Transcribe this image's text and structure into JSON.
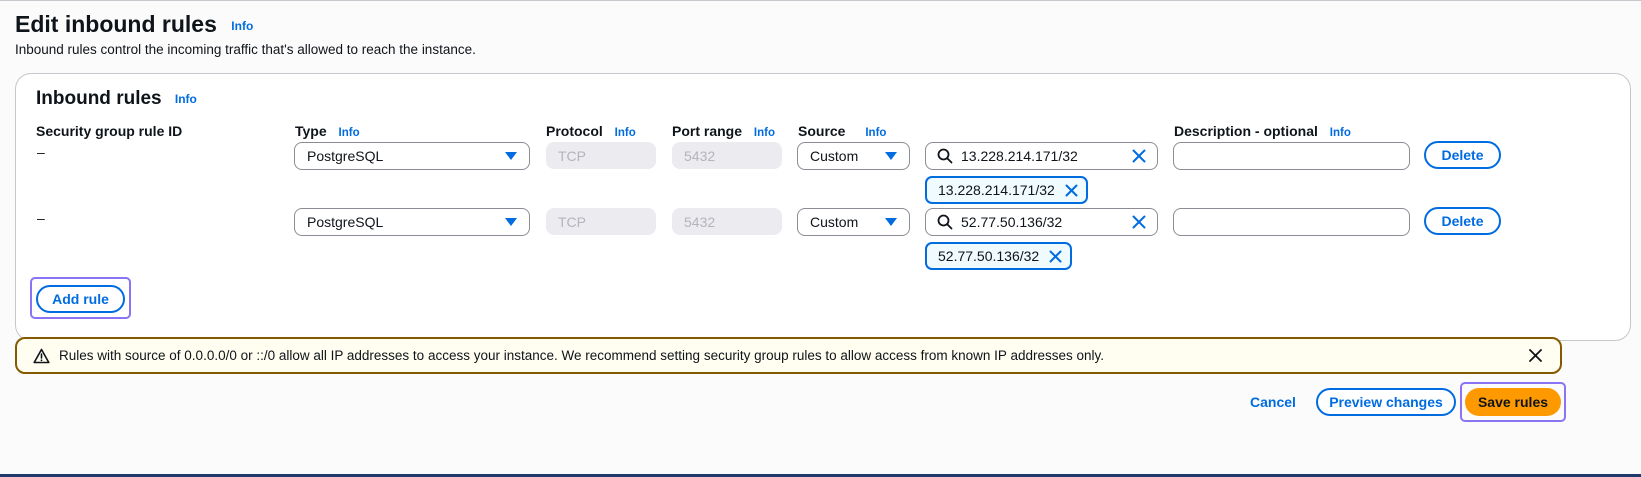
{
  "header": {
    "title": "Edit inbound rules",
    "info": "Info",
    "description": "Inbound rules control the incoming traffic that's allowed to reach the instance."
  },
  "panel": {
    "title": "Inbound rules",
    "info": "Info",
    "columns": {
      "rule_id": "Security group rule ID",
      "type": "Type",
      "protocol": "Protocol",
      "port_range": "Port range",
      "source": "Source",
      "description": "Description - optional",
      "info": "Info"
    },
    "rules": [
      {
        "rule_id": "–",
        "type": "PostgreSQL",
        "protocol": "TCP",
        "port_range": "5432",
        "source": "Custom",
        "cidr_search": "13.228.214.171/32",
        "cidr_token": "13.228.214.171/32",
        "description": "",
        "delete_label": "Delete"
      },
      {
        "rule_id": "–",
        "type": "PostgreSQL",
        "protocol": "TCP",
        "port_range": "5432",
        "source": "Custom",
        "cidr_search": "52.77.50.136/32",
        "cidr_token": "52.77.50.136/32",
        "description": "",
        "delete_label": "Delete"
      }
    ],
    "add_rule_label": "Add rule"
  },
  "alert": {
    "text": "Rules with source of 0.0.0.0/0 or ::/0 allow all IP addresses to access your instance. We recommend setting security group rules to allow access from known IP addresses only."
  },
  "footer": {
    "cancel_label": "Cancel",
    "preview_label": "Preview changes",
    "save_label": "Save rules"
  },
  "colors": {
    "accent": "#006ce0",
    "primary_button": "#ff9900",
    "warning_border": "#855900",
    "focus_ring": "#8a74f5"
  },
  "icons": {
    "search": "search-icon",
    "clear": "clear-icon",
    "token_remove": "remove-token-icon",
    "dropdown": "caret-down-icon",
    "warning": "warning-icon",
    "dismiss": "dismiss-icon"
  }
}
